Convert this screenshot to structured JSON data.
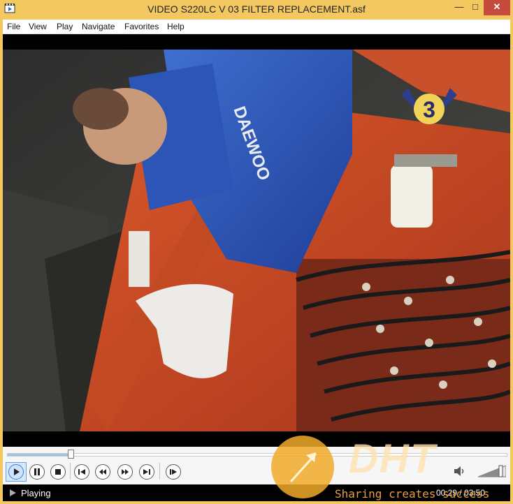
{
  "window": {
    "title": "VIDEO S220LC V 03 FILTER REPLACEMENT.asf",
    "controls": {
      "minimize": "—",
      "maximize": "□",
      "close": "✕"
    }
  },
  "menu": {
    "items": [
      "File",
      "View",
      "Play",
      "Navigate",
      "Favorites",
      "Help"
    ]
  },
  "video": {
    "channel_logo_text": "3",
    "jacket_text": "DAEWOO"
  },
  "seek": {
    "progress_fraction": 0.126
  },
  "controls": {
    "buttons": [
      "play-icon",
      "pause-icon",
      "stop-icon",
      "previous-icon",
      "rewind-icon",
      "fast-forward-icon",
      "next-icon",
      "frame-step-icon"
    ],
    "volume_fraction": 0.8
  },
  "status": {
    "text": "Playing",
    "time": "00:29 / 03:50"
  },
  "watermark": {
    "logo": "DHT",
    "slogan": "Sharing creates success"
  },
  "colors": {
    "title_bar": "#f3c860",
    "close_button": "#c74b3d",
    "status_bar": "#000000",
    "watermark_orange": "#f0aa28"
  }
}
